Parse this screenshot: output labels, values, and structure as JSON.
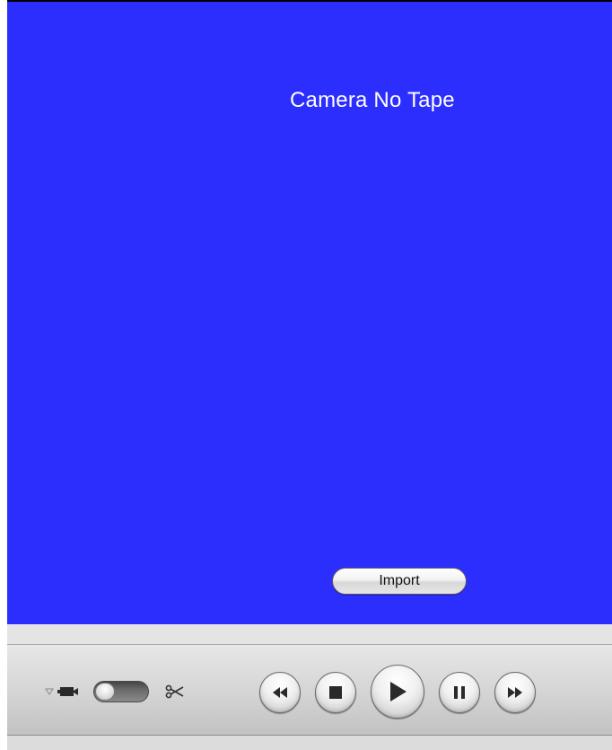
{
  "viewer": {
    "status_text": "Camera No Tape",
    "background_color": "#2b2efc"
  },
  "import_button": {
    "label": "Import"
  },
  "mode_controls": {
    "dropdown_icon": "disclosure-triangle-icon",
    "camera_icon": "camera-icon",
    "mode_switch": "camera-edit-mode-switch",
    "edit_icon": "scissors-icon"
  },
  "transport_controls": [
    {
      "name": "rewind",
      "icon": "rewind-icon"
    },
    {
      "name": "stop",
      "icon": "stop-icon"
    },
    {
      "name": "play",
      "icon": "play-icon"
    },
    {
      "name": "pause",
      "icon": "pause-icon"
    },
    {
      "name": "fast-forward",
      "icon": "fast-forward-icon"
    }
  ]
}
